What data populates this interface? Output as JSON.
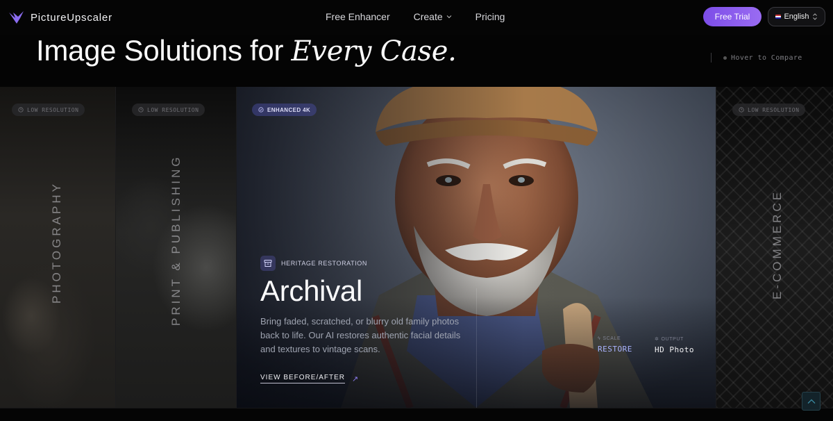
{
  "nav": {
    "brand": "PictureUpscaler",
    "links": [
      "Free Enhancer",
      "Create",
      "Pricing"
    ],
    "cta": "Free Trial",
    "language": "English"
  },
  "hero": {
    "headline_plain": "Image Solutions for ",
    "headline_italic": "Every Case.",
    "hover_hint": "Hover to Compare"
  },
  "panels": {
    "photography": {
      "badge": "LOW RESOLUTION",
      "label": "PHOTOGRAPHY"
    },
    "print": {
      "badge": "LOW RESOLUTION",
      "label": "PRINT & PUBLISHING"
    },
    "archival": {
      "badge": "ENHANCED 4K",
      "category": "HERITAGE RESTORATION",
      "title": "Archival",
      "description": "Bring faded, scratched, or blurry old family photos back to life. Our AI restores authentic facial details and textures to vintage scans.",
      "cta": "VIEW BEFORE/AFTER",
      "scale_key": "SCALE",
      "scale_value": "RESTORE",
      "output_key": "OUTPUT",
      "output_value": "HD Photo"
    },
    "ecommerce": {
      "badge": "LOW RESOLUTION",
      "label": "E-COMMERCE"
    }
  },
  "icons": {
    "logo": "bird-logo-icon",
    "badge": "clock-icon",
    "category": "archive-box-icon",
    "cta": "arrow-up-right-icon",
    "scroll": "chevron-up-icon"
  },
  "colors": {
    "accent": "#8b5cf6",
    "scale_value": "#aab4ff",
    "background": "#040404"
  }
}
